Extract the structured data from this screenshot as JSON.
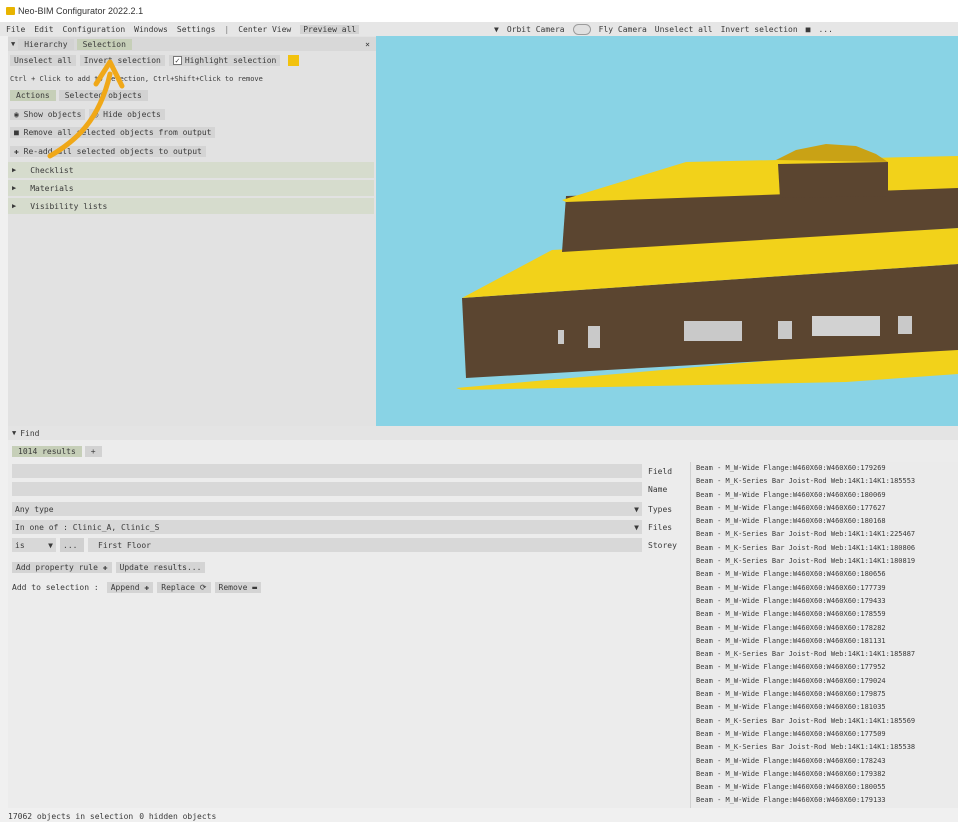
{
  "window": {
    "title": "Neo-BIM Configurator 2022.2.1"
  },
  "menu": {
    "items": [
      "File",
      "Edit",
      "Configuration",
      "Windows",
      "Settings"
    ],
    "separator": "|",
    "center_view": "Center View",
    "preview_all": "Preview all"
  },
  "camera": {
    "orbit": "Orbit Camera",
    "fly": "Fly Camera",
    "unselect_all": "Unselect all",
    "invert": "Invert selection",
    "more": "..."
  },
  "hierarchy": {
    "tabs": [
      "Hierarchy",
      "Selection"
    ],
    "close": "×",
    "unselect_all": "Unselect all",
    "invert_selection": "Invert selection",
    "highlight_selection": "Highlight selection",
    "hint": "Ctrl + Click to add to selection, Ctrl+Shift+Click to remove",
    "subtabs": [
      "Actions",
      "Selected objects"
    ],
    "show_objects": "Show objects",
    "hide_objects": "Hide objects",
    "remove_all": "Remove all selected objects from output",
    "readd_all": "Re-add all selected objects to output",
    "sections": [
      "Checklist",
      "Materials",
      "Visibility lists"
    ],
    "highlight_color": "#f2c20e"
  },
  "find": {
    "title": "Find",
    "results_tab": "1014 results",
    "add_tab": "+",
    "field_labels": [
      "Field",
      "Name",
      "Types",
      "Files",
      "Storey"
    ],
    "any_type": "Any type",
    "files_filter": "In one of : Clinic_A, Clinic_S",
    "operator": "is",
    "ellipsis": "...",
    "storey_value": "First Floor",
    "add_rule": "Add property rule",
    "update": "Update results...",
    "add_to_selection": "Add to selection :",
    "append": "Append",
    "replace": "Replace",
    "remove": "Remove"
  },
  "results": [
    "Beam - M_W-Wide Flange:W460X60:W460X60:179269",
    "Beam - M_K-Series Bar Joist-Rod Web:14K1:14K1:185553",
    "Beam - M_W-Wide Flange:W460X60:W460X60:180069",
    "Beam - M_W-Wide Flange:W460X60:W460X60:177627",
    "Beam - M_W-Wide Flange:W460X60:W460X60:180168",
    "Beam - M_K-Series Bar Joist-Rod Web:14K1:14K1:225467",
    "Beam - M_K-Series Bar Joist-Rod Web:14K1:14K1:180806",
    "Beam - M_K-Series Bar Joist-Rod Web:14K1:14K1:180819",
    "Beam - M_W-Wide Flange:W460X60:W460X60:180656",
    "Beam - M_W-Wide Flange:W460X60:W460X60:177739",
    "Beam - M_W-Wide Flange:W460X60:W460X60:179433",
    "Beam - M_W-Wide Flange:W460X60:W460X60:178559",
    "Beam - M_W-Wide Flange:W460X60:W460X60:178282",
    "Beam - M_W-Wide Flange:W460X60:W460X60:181131",
    "Beam - M_K-Series Bar Joist-Rod Web:14K1:14K1:185887",
    "Beam - M_W-Wide Flange:W460X60:W460X60:177952",
    "Beam - M_W-Wide Flange:W460X60:W460X60:179024",
    "Beam - M_W-Wide Flange:W460X60:W460X60:179875",
    "Beam - M_W-Wide Flange:W460X60:W460X60:181035",
    "Beam - M_K-Series Bar Joist-Rod Web:14K1:14K1:185569",
    "Beam - M_W-Wide Flange:W460X60:W460X60:177509",
    "Beam - M_K-Series Bar Joist-Rod Web:14K1:14K1:185538",
    "Beam - M_W-Wide Flange:W460X60:W460X60:178243",
    "Beam - M_W-Wide Flange:W460X60:W460X60:179382",
    "Beam - M_W-Wide Flange:W460X60:W460X60:180055",
    "Beam - M_W-Wide Flange:W460X60:W460X60:179133"
  ],
  "status": {
    "selected": "17062 objects in selection",
    "hidden": "0 hidden objects"
  },
  "colors": {
    "sky": "#89d3e5",
    "roof": "#f2d21a",
    "wall": "#5b4530",
    "accent_arrow": "#f0a818"
  }
}
